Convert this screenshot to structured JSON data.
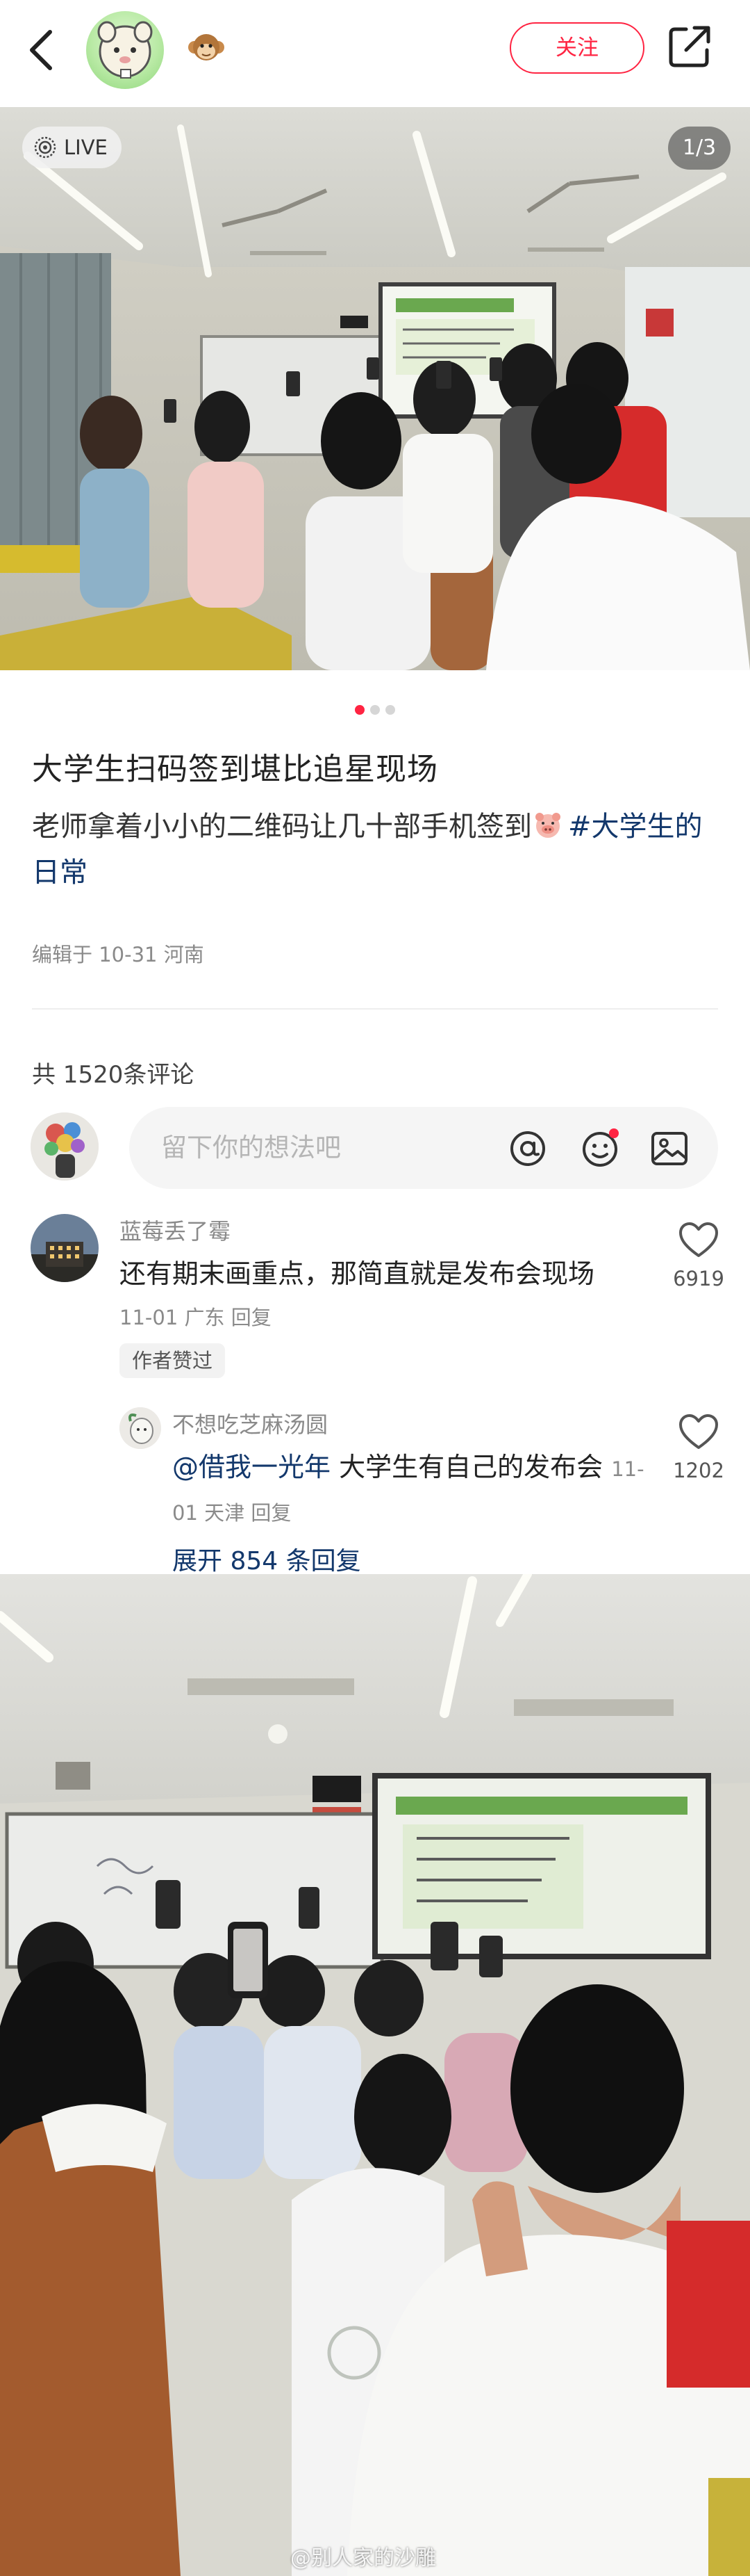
{
  "header": {
    "follow_label": "关注",
    "icons": [
      "back-arrow-icon",
      "monkey-badge-icon",
      "share-icon"
    ]
  },
  "photo1": {
    "live_label": "LIVE",
    "page_indicator": "1/3",
    "carousel_count": 3,
    "carousel_active": 0
  },
  "post": {
    "title": "大学生扫码签到堪比追星现场",
    "desc_text": "老师拿着小小的二维码让几十部手机签到",
    "hashtag": "#大学生的日常",
    "meta": "编辑于 10-31 河南"
  },
  "comments": {
    "count_label": "共 1520条评论",
    "input_placeholder": "留下你的想法吧",
    "items": [
      {
        "name": "蓝莓丢了霉",
        "text": "还有期末画重点，那简直就是发布会现场",
        "meta": "11-01 广东 回复",
        "author_liked": "作者赞过",
        "likes": "6919"
      },
      {
        "name": "不想吃芝麻汤圆",
        "mention": "@借我一光年",
        "text": " 大学生有自己的发布会",
        "meta": "11-01 天津 回复",
        "likes": "1202"
      }
    ],
    "expand_label": "展开 854 条回复"
  },
  "photo2": {
    "watermark": "@别人家的沙雕"
  },
  "colors": {
    "brand_red": "#ff2442",
    "link_blue": "#13386c",
    "muted_gray": "#8a8a8a"
  }
}
